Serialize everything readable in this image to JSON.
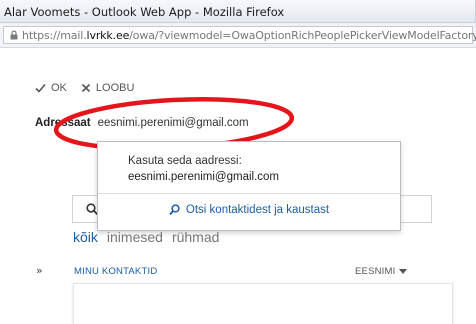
{
  "window": {
    "title": "Alar Voomets - Outlook Web App - Mozilla Firefox",
    "url_prefix": "https://mail.",
    "url_domain": "lvrkk.ee",
    "url_rest": "/owa/?viewmodel=OwaOptionRichPeoplePickerViewModelFactory"
  },
  "toolbar": {
    "ok_label": "OK",
    "cancel_label": "LOOBU"
  },
  "recipient": {
    "label": "Adressaat",
    "value": "eesnimi.perenimi@gmail.com"
  },
  "suggestions": {
    "use_address_label": "Kasuta seda aadressi:",
    "use_address_email": "eesnimi.perenimi@gmail.com",
    "search_link_label": "Otsi kontaktidest ja kaustast"
  },
  "filters": [
    {
      "label": "kõik",
      "active": true
    },
    {
      "label": "inimesed",
      "active": false
    },
    {
      "label": "rühmad",
      "active": false
    }
  ],
  "contacts": {
    "expand_glyph": "»",
    "section_label": "MINU KONTAKTID",
    "sort_label": "EESNIMI"
  },
  "colors": {
    "accent": "#1a5ea6",
    "annotation_ellipse": "#e4151b"
  }
}
